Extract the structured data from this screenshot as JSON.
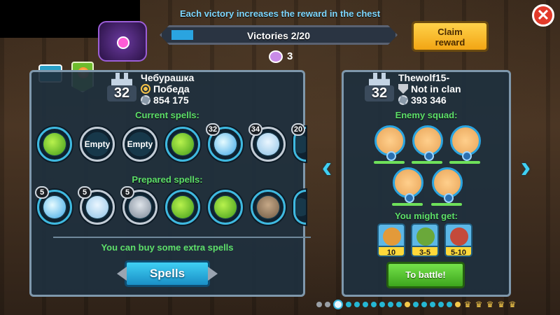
{
  "header": {
    "banner_text": "Each victory increases the reward in the chest",
    "victories_label": "Victories 2/20",
    "victories_progress": 0.1,
    "claim_label": "Claim\nreward",
    "close_symbol": "✕",
    "token_count": "3"
  },
  "player": {
    "level": "32",
    "name": "Чебурашка",
    "clan": "Победа",
    "power": "854 175"
  },
  "left_panel": {
    "current_spells_label": "Current spells:",
    "current_spells": [
      {
        "type": "green",
        "label": ""
      },
      {
        "type": "empty",
        "label": "Empty"
      },
      {
        "type": "empty",
        "label": "Empty"
      },
      {
        "type": "green",
        "label": ""
      },
      {
        "type": "ice",
        "label": "",
        "count": "32"
      },
      {
        "type": "bear",
        "label": "",
        "count": "34"
      },
      {
        "type": "partial",
        "label": "",
        "count": "20"
      }
    ],
    "prepared_spells_label": "Prepared spells:",
    "prepared_spells": [
      {
        "type": "ice",
        "count": "5"
      },
      {
        "type": "bear",
        "count": "5"
      },
      {
        "type": "knight",
        "count": "5"
      },
      {
        "type": "green",
        "count": ""
      },
      {
        "type": "green",
        "count": ""
      },
      {
        "type": "golem",
        "count": ""
      },
      {
        "type": "partial",
        "count": ""
      }
    ],
    "extra_text": "You can buy some extra spells",
    "spells_button": "Spells"
  },
  "enemy": {
    "level": "32",
    "name": "Thewolf15-",
    "clan": "Not in clan",
    "power": "393 346",
    "squad_label": "Enemy squad:",
    "might_get_label": "You might get:",
    "rewards": [
      {
        "qty": "10",
        "color": "#e39a3a"
      },
      {
        "qty": "3-5",
        "color": "#6aa83a"
      },
      {
        "qty": "5-10",
        "color": "#c44a3a"
      }
    ],
    "battle_button": "To battle!"
  },
  "colors": {
    "accent_cyan": "#3fb9e0",
    "green_text": "#5ee06a",
    "gold": "#f3c84a",
    "close_red": "#e23a2a"
  },
  "pager": {
    "dots": [
      "grey",
      "grey",
      "big",
      "cyan",
      "cyan",
      "cyan",
      "cyan",
      "cyan",
      "cyan",
      "cyan",
      "gold",
      "cyan",
      "cyan",
      "cyan",
      "cyan",
      "cyan",
      "gold",
      "crown",
      "crown",
      "crown",
      "crown",
      "crown"
    ]
  },
  "icons": {
    "close": "close-icon",
    "token": "token-icon",
    "left_arrow": "chevron-left-icon",
    "right_arrow": "chevron-right-icon"
  }
}
